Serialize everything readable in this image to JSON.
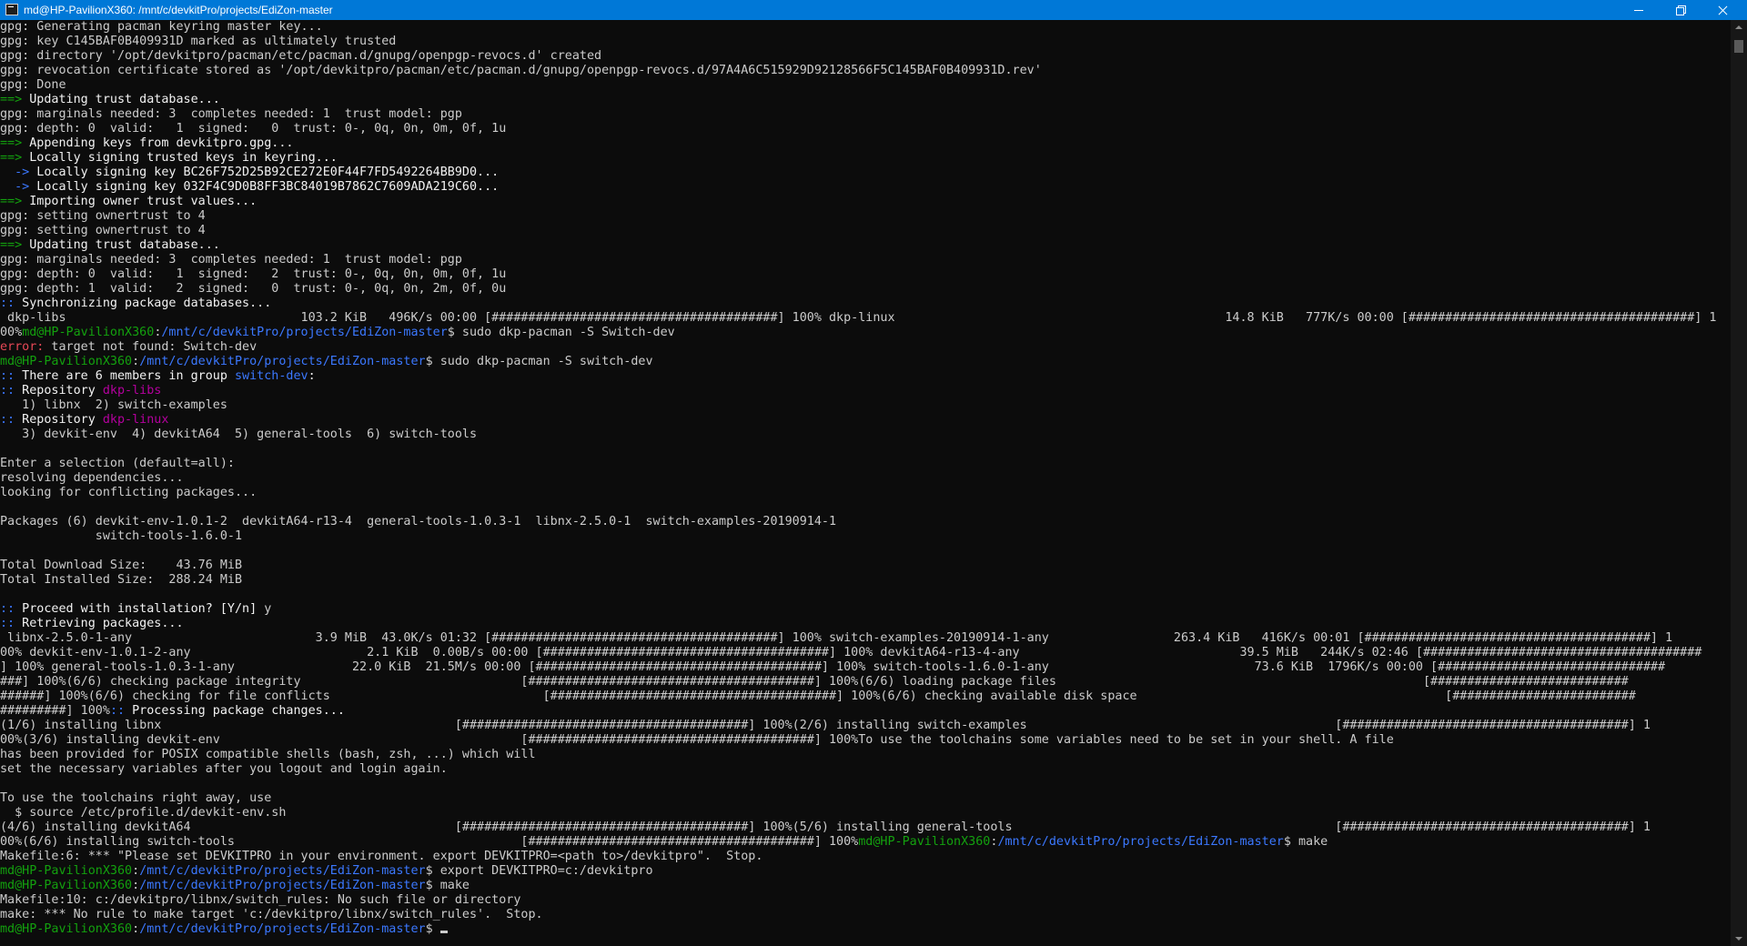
{
  "window": {
    "title": "md@HP-PavilionX360: /mnt/c/devkitPro/projects/EdiZon-master",
    "controls": [
      {
        "name": "minimize",
        "icon": "minimize-icon"
      },
      {
        "name": "maximize",
        "icon": "restore-icon"
      },
      {
        "name": "close",
        "icon": "close-icon"
      }
    ]
  },
  "colors": {
    "background": "#0c0c0c",
    "text": "#cccccc",
    "prompt_user": "#13a10e",
    "prompt_path": "#3b78ff",
    "arrow_blue": "#3b78ff",
    "error": "#e74856",
    "repo_magenta": "#b4009e",
    "titlebar": "#0078d7"
  },
  "terminal": {
    "lines": [
      [
        {
          "t": "gpg: Generating pacman keyring master key...",
          "c": "gray"
        }
      ],
      [
        {
          "t": "gpg: key C145BAF0B409931D marked as ultimately trusted",
          "c": "gray"
        }
      ],
      [
        {
          "t": "gpg: directory '/opt/devkitpro/pacman/etc/pacman.d/gnupg/openpgp-revocs.d' created",
          "c": "gray"
        }
      ],
      [
        {
          "t": "gpg: revocation certificate stored as '/opt/devkitpro/pacman/etc/pacman.d/gnupg/openpgp-revocs.d/97A4A6C515929D92128566F5C145BAF0B409931D.rev'",
          "c": "gray"
        }
      ],
      [
        {
          "t": "gpg: Done",
          "c": "gray"
        }
      ],
      [
        {
          "t": "==>",
          "c": "green"
        },
        {
          "t": " Updating trust database...",
          "c": "white"
        }
      ],
      [
        {
          "t": "gpg: marginals needed: 3  completes needed: 1  trust model: pgp",
          "c": "gray"
        }
      ],
      [
        {
          "t": "gpg: depth: 0  valid:   1  signed:   0  trust: 0-, 0q, 0n, 0m, 0f, 1u",
          "c": "gray"
        }
      ],
      [
        {
          "t": "==>",
          "c": "green"
        },
        {
          "t": " Appending keys from devkitpro.gpg...",
          "c": "white"
        }
      ],
      [
        {
          "t": "==>",
          "c": "green"
        },
        {
          "t": " Locally signing trusted keys in keyring...",
          "c": "white"
        }
      ],
      [
        {
          "t": "  ->",
          "c": "blue"
        },
        {
          "t": " Locally signing key BC26F752D25B92CE272E0F44F7FD5492264BB9D0...",
          "c": "white"
        }
      ],
      [
        {
          "t": "  ->",
          "c": "blue"
        },
        {
          "t": " Locally signing key 032F4C9D0B8FF3BC84019B7862C7609ADA219C60...",
          "c": "white"
        }
      ],
      [
        {
          "t": "==>",
          "c": "green"
        },
        {
          "t": " Importing owner trust values...",
          "c": "white"
        }
      ],
      [
        {
          "t": "gpg: setting ownertrust to 4",
          "c": "gray"
        }
      ],
      [
        {
          "t": "gpg: setting ownertrust to 4",
          "c": "gray"
        }
      ],
      [
        {
          "t": "==>",
          "c": "green"
        },
        {
          "t": " Updating trust database...",
          "c": "white"
        }
      ],
      [
        {
          "t": "gpg: marginals needed: 3  completes needed: 1  trust model: pgp",
          "c": "gray"
        }
      ],
      [
        {
          "t": "gpg: depth: 0  valid:   1  signed:   2  trust: 0-, 0q, 0n, 0m, 0f, 1u",
          "c": "gray"
        }
      ],
      [
        {
          "t": "gpg: depth: 1  valid:   2  signed:   0  trust: 0-, 0q, 0n, 2m, 0f, 0u",
          "c": "gray"
        }
      ],
      [
        {
          "t": "::",
          "c": "blue"
        },
        {
          "t": " Synchronizing package databases...",
          "c": "white"
        }
      ],
      [
        {
          "t": " dkp-libs                                103.2 KiB   496K/s 00:00 [#######################################] 100% dkp-linux                                             14.8 KiB   777K/s 00:00 [#######################################] 1",
          "c": "gray"
        }
      ],
      [
        {
          "t": "00%",
          "c": "gray"
        },
        {
          "t": "md@HP-PavilionX360",
          "c": "green"
        },
        {
          "t": ":",
          "c": "gray"
        },
        {
          "t": "/mnt/c/devkitPro/projects/EdiZon-master",
          "c": "blue"
        },
        {
          "t": "$ sudo dkp-pacman -S Switch-dev",
          "c": "gray"
        }
      ],
      [
        {
          "t": "error:",
          "c": "red"
        },
        {
          "t": " target not found: Switch-dev",
          "c": "gray"
        }
      ],
      [
        {
          "t": "md@HP-PavilionX360",
          "c": "green"
        },
        {
          "t": ":",
          "c": "gray"
        },
        {
          "t": "/mnt/c/devkitPro/projects/EdiZon-master",
          "c": "blue"
        },
        {
          "t": "$ sudo dkp-pacman -S switch-dev",
          "c": "gray"
        }
      ],
      [
        {
          "t": "::",
          "c": "blue"
        },
        {
          "t": " There are 6 members in group ",
          "c": "white"
        },
        {
          "t": "switch-dev",
          "c": "blue"
        },
        {
          "t": ":",
          "c": "white"
        }
      ],
      [
        {
          "t": "::",
          "c": "blue"
        },
        {
          "t": " Repository ",
          "c": "white"
        },
        {
          "t": "dkp-libs",
          "c": "magenta"
        }
      ],
      [
        {
          "t": "   1) libnx  2) switch-examples",
          "c": "gray"
        }
      ],
      [
        {
          "t": "::",
          "c": "blue"
        },
        {
          "t": " Repository ",
          "c": "white"
        },
        {
          "t": "dkp-linux",
          "c": "magenta"
        }
      ],
      [
        {
          "t": "   3) devkit-env  4) devkitA64  5) general-tools  6) switch-tools",
          "c": "gray"
        }
      ],
      [
        {
          "t": "",
          "c": "gray"
        }
      ],
      [
        {
          "t": "Enter a selection (default=all):",
          "c": "gray"
        }
      ],
      [
        {
          "t": "resolving dependencies...",
          "c": "gray"
        }
      ],
      [
        {
          "t": "looking for conflicting packages...",
          "c": "gray"
        }
      ],
      [
        {
          "t": "",
          "c": "gray"
        }
      ],
      [
        {
          "t": "Packages (6) devkit-env-1.0.1-2  devkitA64-r13-4  general-tools-1.0.3-1  libnx-2.5.0-1  switch-examples-20190914-1",
          "c": "gray"
        }
      ],
      [
        {
          "t": "             switch-tools-1.6.0-1",
          "c": "gray"
        }
      ],
      [
        {
          "t": "",
          "c": "gray"
        }
      ],
      [
        {
          "t": "Total Download Size:    43.76 MiB",
          "c": "gray"
        }
      ],
      [
        {
          "t": "Total Installed Size:  288.24 MiB",
          "c": "gray"
        }
      ],
      [
        {
          "t": "",
          "c": "gray"
        }
      ],
      [
        {
          "t": "::",
          "c": "blue"
        },
        {
          "t": " Proceed with installation? [Y/n] ",
          "c": "white"
        },
        {
          "t": "y",
          "c": "gray"
        }
      ],
      [
        {
          "t": "::",
          "c": "blue"
        },
        {
          "t": " Retrieving packages...",
          "c": "white"
        }
      ],
      [
        {
          "t": " libnx-2.5.0-1-any                         3.9 MiB  43.0K/s 01:32 [#######################################] 100% switch-examples-20190914-1-any                 263.4 KiB   416K/s 00:01 [#######################################] 1",
          "c": "gray"
        }
      ],
      [
        {
          "t": "00% devkit-env-1.0.1-2-any                        2.1 KiB  0.00B/s 00:00 [#######################################] 100% devkitA64-r13-4-any                              39.5 MiB   244K/s 02:46 [######################################",
          "c": "gray"
        }
      ],
      [
        {
          "t": "] 100% general-tools-1.0.3-1-any                22.0 KiB  21.5M/s 00:00 [#######################################] 100% switch-tools-1.6.0-1-any                            73.6 KiB  1796K/s 00:00 [###############################",
          "c": "gray"
        }
      ],
      [
        {
          "t": "###] 100%(6/6) checking package integrity                              [#######################################] 100%(6/6) loading package files                                                  [###########################",
          "c": "gray"
        }
      ],
      [
        {
          "t": "######] 100%(6/6) checking for file conflicts                             [#######################################] 100%(6/6) checking available disk space                                          [#########################",
          "c": "gray"
        }
      ],
      [
        {
          "t": "#########] 100%",
          "c": "gray"
        },
        {
          "t": "::",
          "c": "blue"
        },
        {
          "t": " Processing package changes...",
          "c": "white"
        }
      ],
      [
        {
          "t": "(1/6) installing libnx                                        [#######################################] 100%(2/6) installing switch-examples                                          [#######################################] 1",
          "c": "gray"
        }
      ],
      [
        {
          "t": "00%(3/6) installing devkit-env                                         [#######################################] 100%To use the toolchains some variables need to be set in your shell. A file",
          "c": "gray"
        }
      ],
      [
        {
          "t": "has been provided for POSIX compatible shells (bash, zsh, ...) which will",
          "c": "gray"
        }
      ],
      [
        {
          "t": "set the necessary variables after you logout and login again.",
          "c": "gray"
        }
      ],
      [
        {
          "t": "",
          "c": "gray"
        }
      ],
      [
        {
          "t": "To use the toolchains right away, use",
          "c": "gray"
        }
      ],
      [
        {
          "t": "  $ source /etc/profile.d/devkit-env.sh",
          "c": "gray"
        }
      ],
      [
        {
          "t": "(4/6) installing devkitA64                                    [#######################################] 100%(5/6) installing general-tools                                            [#######################################] 1",
          "c": "gray"
        }
      ],
      [
        {
          "t": "00%(6/6) installing switch-tools                                       [#######################################] 100%",
          "c": "gray"
        },
        {
          "t": "md@HP-PavilionX360",
          "c": "green"
        },
        {
          "t": ":",
          "c": "gray"
        },
        {
          "t": "/mnt/c/devkitPro/projects/EdiZon-master",
          "c": "blue"
        },
        {
          "t": "$ make",
          "c": "gray"
        }
      ],
      [
        {
          "t": "Makefile:6: *** \"Please set DEVKITPRO in your environment. export DEVKITPRO=<path to>/devkitpro\".  Stop.",
          "c": "gray"
        }
      ],
      [
        {
          "t": "md@HP-PavilionX360",
          "c": "green"
        },
        {
          "t": ":",
          "c": "gray"
        },
        {
          "t": "/mnt/c/devkitPro/projects/EdiZon-master",
          "c": "blue"
        },
        {
          "t": "$ export DEVKITPRO=c:/devkitpro",
          "c": "gray"
        }
      ],
      [
        {
          "t": "md@HP-PavilionX360",
          "c": "green"
        },
        {
          "t": ":",
          "c": "gray"
        },
        {
          "t": "/mnt/c/devkitPro/projects/EdiZon-master",
          "c": "blue"
        },
        {
          "t": "$ make",
          "c": "gray"
        }
      ],
      [
        {
          "t": "Makefile:10: c:/devkitpro/libnx/switch_rules: No such file or directory",
          "c": "gray"
        }
      ],
      [
        {
          "t": "make: *** No rule to make target 'c:/devkitpro/libnx/switch_rules'.  Stop.",
          "c": "gray"
        }
      ],
      [
        {
          "t": "md@HP-PavilionX360",
          "c": "green"
        },
        {
          "t": ":",
          "c": "gray"
        },
        {
          "t": "/mnt/c/devkitPro/projects/EdiZon-master",
          "c": "blue"
        },
        {
          "t": "$ ",
          "c": "gray"
        }
      ]
    ]
  },
  "scrollbar": {
    "up_icon": "scroll-up-arrow-icon",
    "down_icon": "scroll-down-arrow-icon"
  }
}
